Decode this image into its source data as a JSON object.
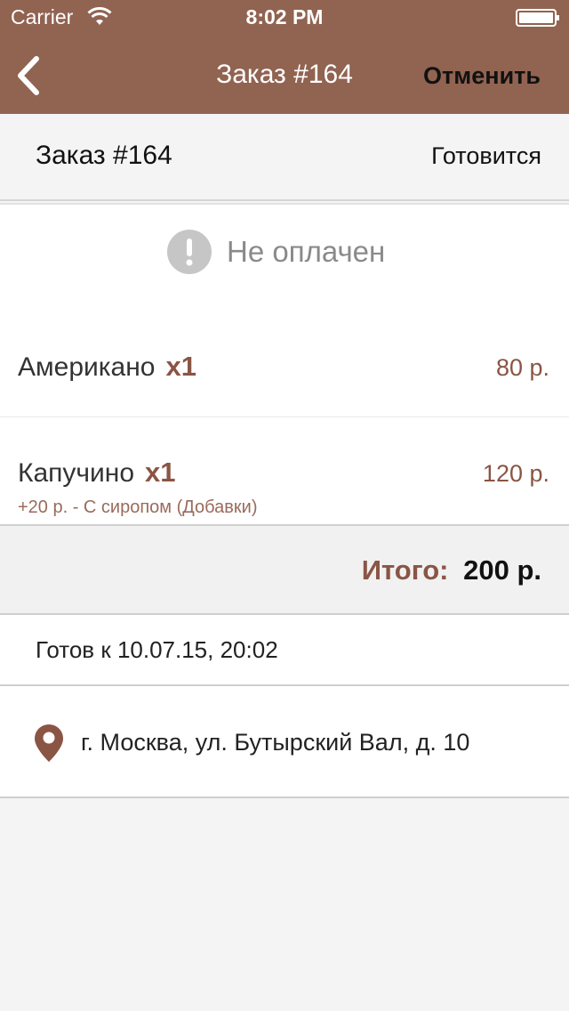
{
  "status_bar": {
    "carrier": "Carrier",
    "time": "8:02 PM"
  },
  "nav": {
    "title": "Заказ #164",
    "cancel_label": "Отменить",
    "back_icon": "chevron-left-icon"
  },
  "order": {
    "title": "Заказ #164",
    "status": "Готовится"
  },
  "payment": {
    "status_label": "Не оплачен",
    "icon": "alert-icon"
  },
  "items": [
    {
      "name": "Американо",
      "qty": "x1",
      "price": "80 р."
    },
    {
      "name": "Капучино",
      "qty": "x1",
      "price": "120 р.",
      "addon": "+20 р. - С сиропом (Добавки)"
    }
  ],
  "total": {
    "label": "Итого:",
    "value": "200 р."
  },
  "ready": {
    "text": "Готов к 10.07.15, 20:02"
  },
  "address": {
    "text": "г. Москва, ул. Бутырский Вал, д. 10",
    "icon": "map-pin-icon"
  },
  "colors": {
    "header_bg": "#916351",
    "accent": "#8a5544",
    "background": "#f4f4f4"
  }
}
